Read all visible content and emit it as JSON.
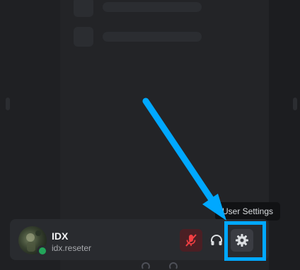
{
  "tooltip": {
    "text": "User Settings"
  },
  "user": {
    "display_name": "IDX",
    "username": "idx.reseter",
    "status_color": "#23a55a"
  },
  "controls": [
    {
      "name": "microphone-muted-icon",
      "state": "muted",
      "color": "#f23f43"
    },
    {
      "name": "headphones-icon"
    },
    {
      "name": "gear-icon"
    }
  ],
  "annotation": {
    "highlight_color": "#00a8ff",
    "target": "gear-icon"
  }
}
